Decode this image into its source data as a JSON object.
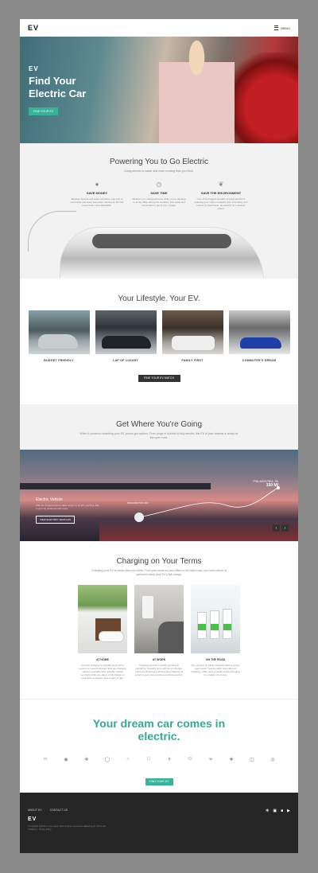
{
  "header": {
    "logo": "EV",
    "menu_label": "MENU"
  },
  "hero": {
    "logo": "EV",
    "title": "Find Your Electric Car",
    "button": "FIND YOUR EV"
  },
  "power": {
    "title": "Powering You to Go Electric",
    "subtitle": "Going electric is easier and more exciting than you think.",
    "benefits": [
      {
        "icon": "piggy-bank-icon",
        "title": "SAVE MONEY",
        "desc": "Between federal and state incentives, low cost of ownership and lower fuel costs, owning an EV has never been more affordable."
      },
      {
        "icon": "clock-icon",
        "title": "SAVE TIME",
        "desc": "Whether you charge at home while you're sleeping or at the office during the workday, EVs quick and convenient to get to your charge."
      },
      {
        "icon": "leaf-icon",
        "title": "SAVE THE ENVIRONMENT",
        "desc": "One of the biggest benefits of going electric is reducing your carbon footprint and minimizing your impact on fossil fuels. Go electric for a cleaner planet."
      }
    ]
  },
  "lifestyle": {
    "title": "Your Lifestyle. Your EV.",
    "cards": [
      {
        "caption": "BUDGET FRIENDLY"
      },
      {
        "caption": "LAP OF LUXURY"
      },
      {
        "caption": "FAMILY FIRST"
      },
      {
        "caption": "COMMUTER'S DREAM"
      }
    ],
    "button": "FIND YOUR EV MATCH"
  },
  "where": {
    "title": "Get Where You're Going",
    "subtitle": "When it comes to switching your EV, you've got options. From plugs in hybrids to fully electric, the EV of your dreams is ready for the open road.",
    "info_title": "Electric Vehicle",
    "info_desc": "With the longest best-in-class range for an EV, you'll be able to go long distances with ease.",
    "button": "VIEW ELECTRIC VEHICLES",
    "origin": "WASHINGTON, DC",
    "city": "PHILADELPHIA, PA",
    "miles": "150 MI",
    "prev": "‹",
    "next": "›"
  },
  "charging": {
    "title": "Charging on Your Terms",
    "subtitle": "Charging your EV is easier than you think. From your home to your office to the open road, you have plenty of options to keep your EV's full charge.",
    "cards": [
      {
        "title": "AT HOME",
        "desc": "At home charging is typically done with a Level 1 or Level 2 charger. EVs are charging stations specially. EVs typically charge overnight while you sleep. A full charge on most EVs is cheaper than a tank of gas."
      },
      {
        "title": "AT WORK",
        "desc": "Charging at work is quickly growing in popularity. Typically done with an L2 charger, many employers are offering free charging as a perk to get more employees driving electric."
      },
      {
        "title": "ON THE ROAD",
        "desc": "The number of public charging stations grows each week. Typical public sites offer L2 charging, while some provide L3 fast charging in a matter of minutes."
      }
    ]
  },
  "dream": {
    "title": "Your dream car comes in electric.",
    "brands": [
      "audi",
      "bmw",
      "cadillac",
      "vw",
      "mini",
      "honda",
      "tesla",
      "ford",
      "mercedes",
      "chevy",
      "porsche",
      "hyundai"
    ],
    "button": "FIND YOUR EV"
  },
  "footer": {
    "links": [
      "ABOUT EV",
      "CONTACT US"
    ],
    "logo": "EV",
    "copyright": "© Copyright 2019 EV. Lorem ipsum dolor sit amet, consectetur adipiscing elit. Terms and Conditions · Privacy Policy",
    "social": [
      "twitter-icon",
      "linkedin-icon",
      "facebook-icon",
      "youtube-icon"
    ]
  },
  "colors": {
    "accent": "#35b49a",
    "dark": "#262626",
    "bg": "#f2f2f2"
  }
}
